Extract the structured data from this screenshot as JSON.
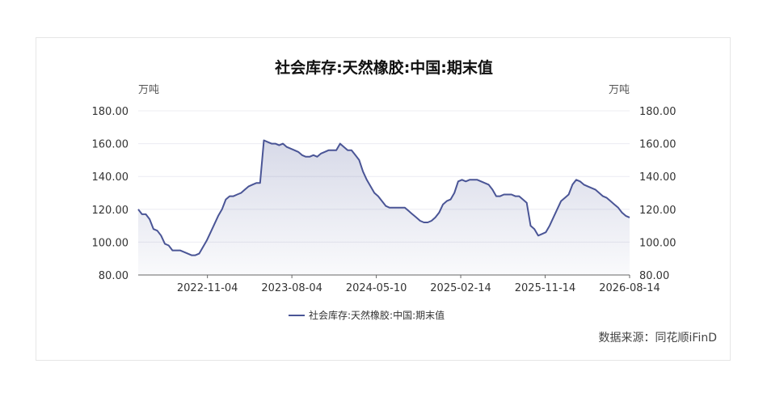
{
  "chart_data": {
    "type": "area",
    "title": "社会库存:天然橡胶:中国:期末值",
    "y_unit_left": "万吨",
    "y_unit_right": "万吨",
    "ylim": [
      80,
      180
    ],
    "yticks": [
      "80.00",
      "100.00",
      "120.00",
      "140.00",
      "160.00",
      "180.00"
    ],
    "xticks": [
      "2022-11-04",
      "2023-08-04",
      "2024-05-10",
      "2025-02-14",
      "2025-11-14",
      "2026-08-14"
    ],
    "grid": true,
    "legend_position": "bottom",
    "series": [
      {
        "name": "社会库存:天然橡胶:中国:期末值",
        "color": "#4a5596",
        "values": [
          120,
          117,
          117,
          114,
          108,
          107,
          104,
          99,
          98,
          95,
          95,
          95,
          94,
          93,
          92,
          92,
          93,
          97,
          101,
          106,
          111,
          116,
          120,
          126,
          128,
          128,
          129,
          130,
          132,
          134,
          135,
          136,
          136,
          162,
          161,
          160,
          160,
          159,
          160,
          158,
          157,
          156,
          155,
          153,
          152,
          152,
          153,
          152,
          154,
          155,
          156,
          156,
          156,
          160,
          158,
          156,
          156,
          153,
          150,
          143,
          138,
          134,
          130,
          128,
          125,
          122,
          121,
          121,
          121,
          121,
          121,
          119,
          117,
          115,
          113,
          112,
          112,
          113,
          115,
          118,
          123,
          125,
          126,
          130,
          137,
          138,
          137,
          138,
          138,
          138,
          137,
          136,
          135,
          132,
          128,
          128,
          129,
          129,
          129,
          128,
          128,
          126,
          124,
          110,
          108,
          104,
          105,
          106,
          110,
          115,
          120,
          125,
          127,
          129,
          135,
          138,
          137,
          135,
          134,
          133,
          132,
          130,
          128,
          127,
          125,
          123,
          121,
          118,
          116,
          115
        ]
      }
    ],
    "source_label": "数据来源：同花顺iFinD"
  }
}
